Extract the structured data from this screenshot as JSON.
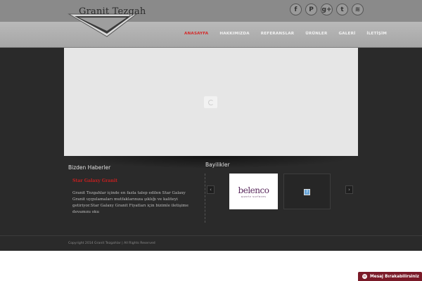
{
  "header": {
    "logo_text": "Granit Tezgah",
    "social_icons": [
      "facebook-icon",
      "pinterest-icon",
      "google-plus-icon",
      "twitter-icon",
      "rss-icon"
    ],
    "social_glyphs": [
      "f",
      "P",
      "g+",
      "t",
      "≋"
    ]
  },
  "menu": {
    "items": [
      "ANASAYFA",
      "HAKKIMIZDA",
      "REFERANSLAR",
      "ÜRÜNLER",
      "GALERİ",
      "İLETİŞİM"
    ],
    "active_color": "#d42a2a"
  },
  "news": {
    "title": "Bizden Haberler",
    "headline": "Star Galaxy Granit",
    "body": "Granit Tezgahlar içinde en fazla talep edilen Star Galaxy Granit uygulamaları mutfaklarınıza şıklığı ve kaliteyi getiriyor.Star Galaxy Granit Fiyatları için bizimle iletişime devamını oku"
  },
  "dealers": {
    "title": "Bayilikler",
    "prev": "‹",
    "next": "›",
    "brand": "belenco",
    "brand_sub": "quartz surfaces",
    "placeholder": "?"
  },
  "footer": {
    "copyright": "Copyright 2014 Granit Tezgahlar | All Rights Reserved"
  },
  "message_button": {
    "label": "Mesaj Bırakabilirsiniz",
    "icon": "✉"
  }
}
